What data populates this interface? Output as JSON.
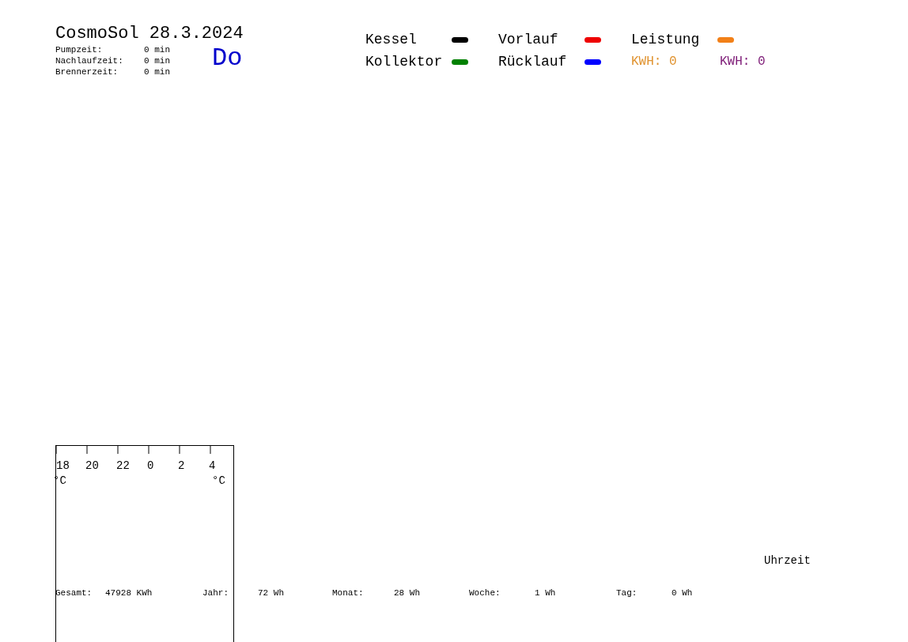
{
  "header": {
    "title": "CosmoSol 28.3.2024",
    "day": "Do",
    "times": [
      {
        "label": "Pumpzeit:",
        "value": "0 min"
      },
      {
        "label": "Nachlaufzeit:",
        "value": "0 min"
      },
      {
        "label": "Brennerzeit:",
        "value": "0 min"
      }
    ]
  },
  "legend": {
    "rows": [
      [
        {
          "kind": "series",
          "label": "Kessel",
          "color": "#000000"
        },
        {
          "kind": "series",
          "label": "Vorlauf",
          "color": "#ee0000"
        },
        {
          "kind": "series",
          "label": "Leistung",
          "color": "#f28018"
        }
      ],
      [
        {
          "kind": "series",
          "label": "Kollektor",
          "color": "#008000"
        },
        {
          "kind": "series",
          "label": "Rücklauf",
          "color": "#0000ff"
        },
        {
          "kind": "total",
          "label": "KWH:",
          "value": "0",
          "color": "#e0922e"
        },
        {
          "kind": "total",
          "label": "KWH:",
          "value": "0",
          "color": "#80207a"
        }
      ]
    ]
  },
  "chart": {
    "ticks": [
      "18",
      "20",
      "22",
      "0",
      "2",
      "4"
    ],
    "unit_left": "°C",
    "unit_right": "°C"
  },
  "x_axis_label": "Uhrzeit",
  "totals": [
    {
      "label": "Gesamt:",
      "value": "47928 KWh"
    },
    {
      "label": "Jahr:",
      "value": "72 Wh"
    },
    {
      "label": "Monat:",
      "value": "28 Wh"
    },
    {
      "label": "Woche:",
      "value": "1 Wh"
    },
    {
      "label": "Tag:",
      "value": "0 Wh"
    }
  ]
}
